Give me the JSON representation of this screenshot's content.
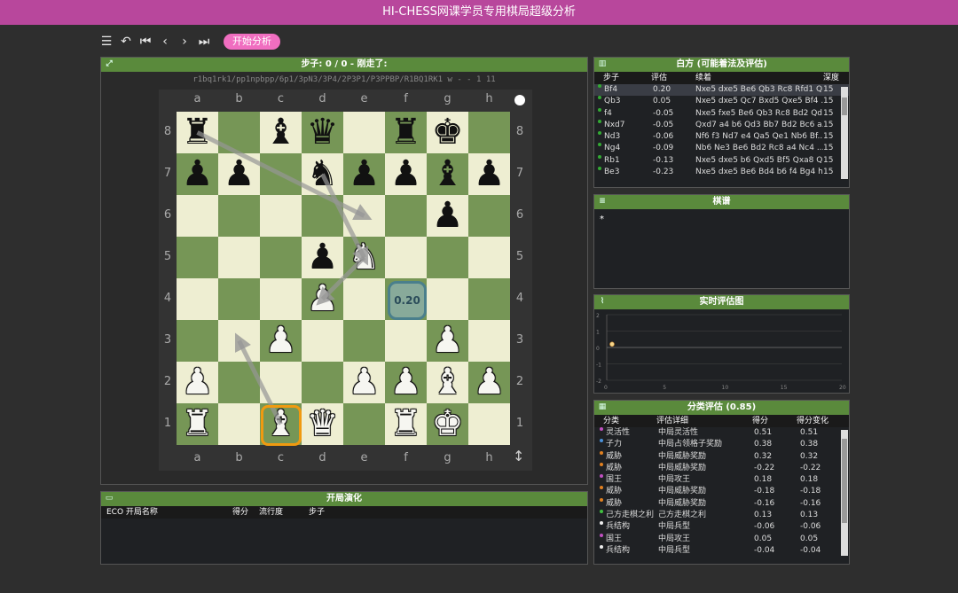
{
  "app_title": "HI-CHESS网课学员专用棋局超级分析",
  "toolbar": {
    "start_label": "开始分析"
  },
  "board_panel": {
    "title": "步子: 0 / 0 - 刚走了:",
    "fen": "r1bq1rk1/pp1npbpp/6p1/3pN3/3P4/2P3P1/P3PPBP/R1BQ1RK1 w - - 1 11",
    "files": [
      "a",
      "b",
      "c",
      "d",
      "e",
      "f",
      "g",
      "h"
    ],
    "ranks": [
      "8",
      "7",
      "6",
      "5",
      "4",
      "3",
      "2",
      "1"
    ],
    "eval_badge": "0.20",
    "pieces": [
      {
        "sq": "a8",
        "g": "♜",
        "c": "b"
      },
      {
        "sq": "c8",
        "g": "♝",
        "c": "b"
      },
      {
        "sq": "d8",
        "g": "♛",
        "c": "b"
      },
      {
        "sq": "f8",
        "g": "♜",
        "c": "b"
      },
      {
        "sq": "g8",
        "g": "♚",
        "c": "b"
      },
      {
        "sq": "a7",
        "g": "♟",
        "c": "b"
      },
      {
        "sq": "b7",
        "g": "♟",
        "c": "b"
      },
      {
        "sq": "d7",
        "g": "♞",
        "c": "b"
      },
      {
        "sq": "e7",
        "g": "♟",
        "c": "b"
      },
      {
        "sq": "f7",
        "g": "♟",
        "c": "b"
      },
      {
        "sq": "g7",
        "g": "♝",
        "c": "b"
      },
      {
        "sq": "h7",
        "g": "♟",
        "c": "b"
      },
      {
        "sq": "g6",
        "g": "♟",
        "c": "b"
      },
      {
        "sq": "d5",
        "g": "♟",
        "c": "b"
      },
      {
        "sq": "e5",
        "g": "♞",
        "c": "w"
      },
      {
        "sq": "d4",
        "g": "♟",
        "c": "w"
      },
      {
        "sq": "c3",
        "g": "♟",
        "c": "w"
      },
      {
        "sq": "g3",
        "g": "♟",
        "c": "w"
      },
      {
        "sq": "a2",
        "g": "♟",
        "c": "w"
      },
      {
        "sq": "e2",
        "g": "♟",
        "c": "w"
      },
      {
        "sq": "f2",
        "g": "♟",
        "c": "w"
      },
      {
        "sq": "g2",
        "g": "♝",
        "c": "w"
      },
      {
        "sq": "h2",
        "g": "♟",
        "c": "w"
      },
      {
        "sq": "a1",
        "g": "♜",
        "c": "w"
      },
      {
        "sq": "c1",
        "g": "♝",
        "c": "w"
      },
      {
        "sq": "d1",
        "g": "♛",
        "c": "w"
      },
      {
        "sq": "f1",
        "g": "♜",
        "c": "w"
      },
      {
        "sq": "g1",
        "g": "♚",
        "c": "w"
      }
    ]
  },
  "opening_panel": {
    "title": "开局演化",
    "headers": [
      "ECO 开局名称",
      "得分",
      "流行度",
      "步子"
    ]
  },
  "white_panel": {
    "title": "白方 (可能着法及评估)",
    "headers": [
      "步子",
      "评估",
      "续着",
      "深度"
    ],
    "rows": [
      {
        "move": "Bf4",
        "eval": "0.20",
        "line": "Nxe5 dxe5 Be6 Qb3 Rc8 Rfd1 Q...",
        "depth": "15"
      },
      {
        "move": "Qb3",
        "eval": "0.05",
        "line": "Nxe5 dxe5 Qc7 Bxd5 Qxe5 Bf4 ...",
        "depth": "15"
      },
      {
        "move": "f4",
        "eval": "-0.05",
        "line": "Nxe5 fxe5 Be6 Qb3 Rc8 Bd2 Qd...",
        "depth": "15"
      },
      {
        "move": "Nxd7",
        "eval": "-0.05",
        "line": "Qxd7 a4 b6 Qd3 Bb7 Bd2 Bc6 a...",
        "depth": "15"
      },
      {
        "move": "Nd3",
        "eval": "-0.06",
        "line": "Nf6 f3 Nd7 e4 Qa5 Qe1 Nb6 Bf...",
        "depth": "15"
      },
      {
        "move": "Ng4",
        "eval": "-0.09",
        "line": "Nb6 Ne3 Be6 Bd2 Rc8 a4 Nc4 ...",
        "depth": "15"
      },
      {
        "move": "Rb1",
        "eval": "-0.13",
        "line": "Nxe5 dxe5 b6 Qxd5 Bf5 Qxa8 Q...",
        "depth": "15"
      },
      {
        "move": "Be3",
        "eval": "-0.23",
        "line": "Nxe5 dxe5 Be6 Bd4 b6 f4 Bg4 h...",
        "depth": "15"
      }
    ]
  },
  "moves_panel": {
    "title": "棋谱",
    "star": "*"
  },
  "graph_panel": {
    "title": "实时评估图",
    "y_ticks": [
      "2",
      "1",
      "0",
      "-1",
      "-2"
    ],
    "x_ticks": [
      "0",
      "5",
      "10",
      "15",
      "20"
    ]
  },
  "chart_data": {
    "type": "line",
    "title": "实时评估图",
    "xlabel": "",
    "ylabel": "",
    "x": [
      0
    ],
    "series": [
      {
        "values": [
          0.2
        ]
      }
    ],
    "xlim": [
      0,
      20
    ],
    "ylim": [
      -2,
      2
    ],
    "x_ticks": [
      0,
      5,
      10,
      15,
      20
    ],
    "y_ticks": [
      2,
      1,
      0,
      -1,
      -2
    ],
    "grid": true
  },
  "category_panel": {
    "title": "分类评估 (0.85)",
    "headers": [
      "分类",
      "评估详细",
      "得分",
      "得分变化"
    ],
    "rows": [
      {
        "cat": "灵活性",
        "detail": "中局灵活性",
        "score": "0.51",
        "delta": "0.51",
        "color": "#c050c0"
      },
      {
        "cat": "子力",
        "detail": "中局占领格子奖励",
        "score": "0.38",
        "delta": "0.38",
        "color": "#4a90d9"
      },
      {
        "cat": "威胁",
        "detail": "中局威胁奖励",
        "score": "0.32",
        "delta": "0.32",
        "color": "#e08020"
      },
      {
        "cat": "威胁",
        "detail": "中局威胁奖励",
        "score": "-0.22",
        "delta": "-0.22",
        "color": "#e08020"
      },
      {
        "cat": "国王",
        "detail": "中局攻王",
        "score": "0.18",
        "delta": "0.18",
        "color": "#c050c0"
      },
      {
        "cat": "威胁",
        "detail": "中局威胁奖励",
        "score": "-0.18",
        "delta": "-0.18",
        "color": "#e08020"
      },
      {
        "cat": "威胁",
        "detail": "中局威胁奖励",
        "score": "-0.16",
        "delta": "-0.16",
        "color": "#e08020"
      },
      {
        "cat": "己方走棋之利",
        "detail": "己方走棋之利",
        "score": "0.13",
        "delta": "0.13",
        "color": "#40c040"
      },
      {
        "cat": "兵结构",
        "detail": "中局兵型",
        "score": "-0.06",
        "delta": "-0.06",
        "color": "#eeeeee"
      },
      {
        "cat": "国王",
        "detail": "中局攻王",
        "score": "0.05",
        "delta": "0.05",
        "color": "#c050c0"
      },
      {
        "cat": "兵结构",
        "detail": "中局兵型",
        "score": "-0.04",
        "delta": "-0.04",
        "color": "#eeeeee"
      }
    ]
  }
}
